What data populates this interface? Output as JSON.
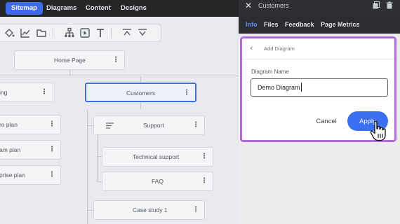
{
  "topbar": {
    "tabs": [
      {
        "label": "Sitemap",
        "active": true
      },
      {
        "label": "Diagrams",
        "active": false
      },
      {
        "label": "Content",
        "active": false
      },
      {
        "label": "Designs",
        "active": false
      }
    ]
  },
  "toolbar": {
    "icons": [
      "fill-bucket-icon",
      "chart-icon",
      "folder-icon",
      "sitemap-icon",
      "play-icon",
      "text-icon",
      "collapse-up-icon",
      "expand-down-icon"
    ]
  },
  "canvas": {
    "cards": {
      "home": "Home Page",
      "left_top": "ing",
      "customers": "Customers",
      "ro_plan": "ro plan",
      "am_plan": "am plan",
      "prise_plan": "prise plan",
      "support": "Support",
      "technical_support": "Technical support",
      "faq": "FAQ",
      "case_study": "Case study 1"
    },
    "dots": "⋮"
  },
  "panel": {
    "title": "Customers",
    "tabs": [
      {
        "label": "Info",
        "active": true
      },
      {
        "label": "Files",
        "active": false
      },
      {
        "label": "Feedback",
        "active": false
      },
      {
        "label": "Page Metrics",
        "active": false
      }
    ]
  },
  "dialog": {
    "title": "Add Diagram",
    "field_label": "Diagram Name",
    "field_value": "Demo Diagram",
    "cancel_label": "Cancel",
    "apply_label": "Apply"
  },
  "colors": {
    "accent": "#3c6ff0",
    "highlight": "#b46bdd",
    "topbar": "#242628"
  }
}
